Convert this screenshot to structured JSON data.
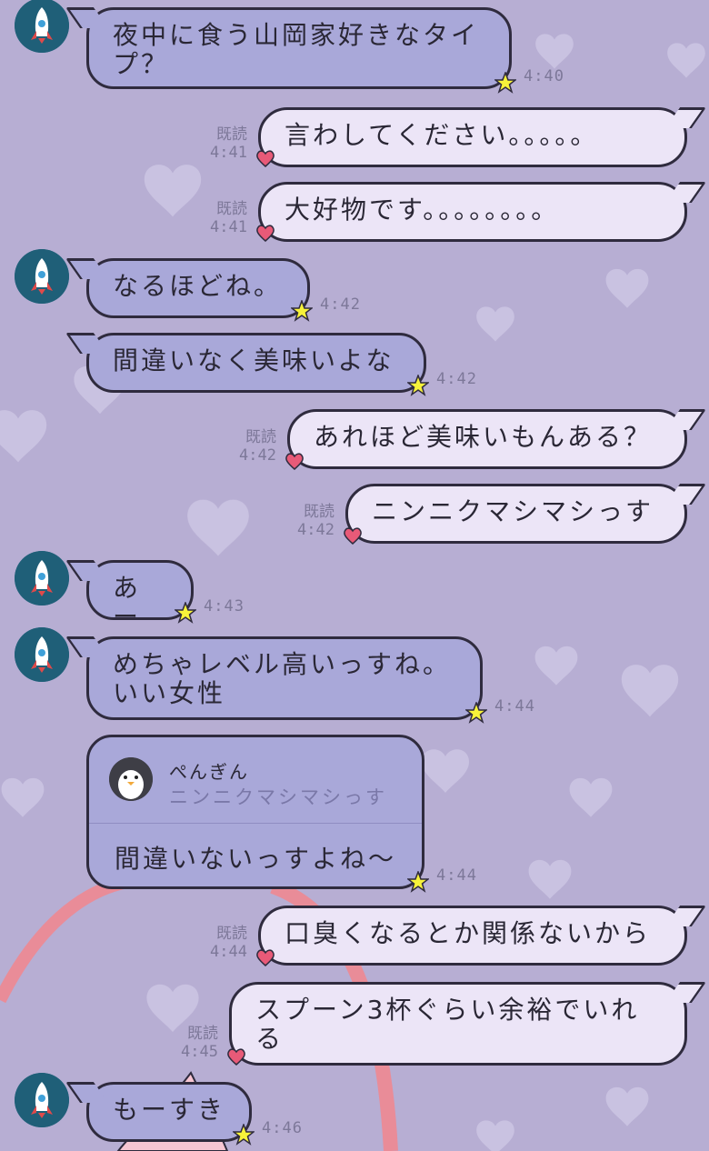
{
  "colors": {
    "background": "#b7aed3",
    "incoming_bubble": "#a9a8d9",
    "outgoing_bubble": "#ece5f7",
    "outline": "#2f2b3e",
    "star": "#f7f23a",
    "heart": "#e85a78",
    "avatar_bg": "#1f5f78"
  },
  "icons": {
    "incoming_avatar": "rocket-icon",
    "incoming_marker": "star-icon",
    "outgoing_marker": "heart-icon",
    "quoted_avatar": "penguin-icon"
  },
  "messages": [
    {
      "direction": "in",
      "text": "夜中に食う山岡家好きなタイ\nプ？",
      "time": "4:40"
    },
    {
      "direction": "out",
      "text": "言わしてください。。。。。",
      "read": "既読",
      "time": "4:41"
    },
    {
      "direction": "out",
      "text": "大好物です。。。。。。。。",
      "read": "既読",
      "time": "4:41"
    },
    {
      "direction": "in",
      "text": "なるほどね。",
      "time": "4:42"
    },
    {
      "direction": "in",
      "text": "間違いなく美味いよな",
      "time": "4:42"
    },
    {
      "direction": "out",
      "text": "あれほど美味いもんある？",
      "read": "既読",
      "time": "4:42"
    },
    {
      "direction": "out",
      "text": "ニンニクマシマシっす",
      "read": "既読",
      "time": "4:42"
    },
    {
      "direction": "in",
      "text": "あー",
      "time": "4:43"
    },
    {
      "direction": "in",
      "text": "めちゃレベル高いっすね。\nいい女性",
      "time": "4:44"
    },
    {
      "direction": "in",
      "quote_name": "ぺんぎん",
      "quote_text": "ニンニクマシマシっす",
      "text": "間違いないっすよね〜",
      "time": "4:44"
    },
    {
      "direction": "out",
      "text": "口臭くなるとか関係ないから",
      "read": "既読",
      "time": "4:44"
    },
    {
      "direction": "out",
      "text": "スプーン3杯ぐらい余裕でいれ\nる",
      "read": "既読",
      "time": "4:45"
    },
    {
      "direction": "in",
      "text": "もーすき",
      "time": "4:46"
    }
  ]
}
